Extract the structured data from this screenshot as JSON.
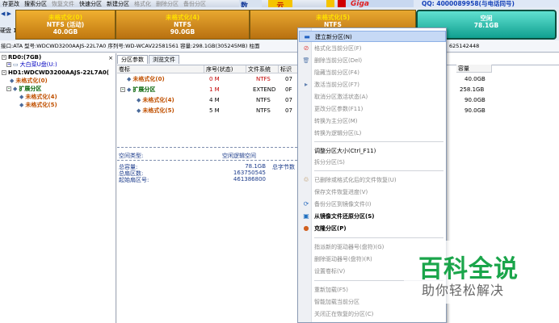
{
  "toolbar": {
    "items": [
      "存更改",
      "搜索分区",
      "恢复文件",
      "快速分区",
      "新建分区",
      "格式化",
      "删除分区",
      "备份分区"
    ],
    "ad_left": "数",
    "ad_mid": "云",
    "ad_brand": "Giga",
    "qq": "QQ: 4000089958(与电话同号)"
  },
  "diskbar": {
    "nav": "◀ ▶",
    "disk_label": "硬盘 1",
    "segments": [
      {
        "name": "未格式化(0)",
        "fs": "NTFS (活动)",
        "size": "40.0GB"
      },
      {
        "name": "未格式化(4)",
        "fs": "NTFS",
        "size": "90.0GB"
      },
      {
        "name": "未格式化(5)",
        "fs": "NTFS",
        "size": ""
      },
      {
        "name": "空闲",
        "fs": "",
        "size": "78.1GB"
      }
    ]
  },
  "infoline": "接口:ATA  型号:WDCWD3200AAJS-22L7A0  序列号:WD-WCAV22581561  容量:298.1GB(305245MB)  柱面",
  "infoline_right": "625142448",
  "tree": {
    "close": "×",
    "nodes": [
      {
        "text": "RD0:(7GB)",
        "color": "dark"
      },
      {
        "text": "大白菜U盘(U:)",
        "color": "blue"
      },
      {
        "text": "HD1:WDCWD3200AAJS-22L7A0(",
        "color": "dark"
      },
      {
        "text": "未格式化(0)",
        "color": "orange"
      },
      {
        "text": "扩展分区",
        "color": "green"
      },
      {
        "text": "未格式化(4)",
        "color": "orange"
      },
      {
        "text": "未格式化(5)",
        "color": "orange"
      }
    ]
  },
  "main": {
    "tabs": [
      "分区参数",
      "浏览文件"
    ],
    "headers": [
      "卷标",
      "序号(状态)",
      "文件系统",
      "标识"
    ],
    "rows": [
      {
        "label": "未格式化(0)",
        "num": "0 M",
        "fs": "NTFS",
        "id": "07",
        "cls": "orange"
      },
      {
        "label": "扩展分区",
        "num": "1 M",
        "fs": "EXTEND",
        "id": "0F",
        "cls": "green"
      },
      {
        "label": "未格式化(4)",
        "num": "4 M",
        "fs": "NTFS",
        "id": "07",
        "cls": "orange"
      },
      {
        "label": "未格式化(5)",
        "num": "5 M",
        "fs": "NTFS",
        "id": "07",
        "cls": "orange"
      }
    ],
    "right_header": "容量",
    "right_values": [
      "40.0GB",
      "258.1GB",
      "90.0GB",
      "90.0GB"
    ],
    "props": {
      "type_label": "空间类型:",
      "type_value": "空闲逻辑空间",
      "total_label": "总容量:",
      "total_value": "78.1GB",
      "bytes_label": "总字节数",
      "sectors_label": "总扇区数:",
      "sectors_value": "163750545",
      "start_label": "起始扇区号:",
      "start_value": "461386800"
    }
  },
  "menu": {
    "items": [
      {
        "label": "建立新分区(N)",
        "state": "sel",
        "icon": "▬"
      },
      {
        "label": "格式化当前分区(F)",
        "state": "dis",
        "icon": "⊘"
      },
      {
        "label": "删除当前分区(Del)",
        "state": "dis",
        "icon": "🗑"
      },
      {
        "label": "隐藏当前分区(F4)",
        "state": "dis",
        "icon": ""
      },
      {
        "label": "激活当前分区(F7)",
        "state": "dis",
        "icon": "▸"
      },
      {
        "label": "取消分区激活状态(A)",
        "state": "dis",
        "icon": ""
      },
      {
        "label": "更改分区参数(F11)",
        "state": "dis",
        "icon": ""
      },
      {
        "label": "转换为主分区(M)",
        "state": "dis",
        "icon": ""
      },
      {
        "label": "转换为逻辑分区(L)",
        "state": "dis",
        "icon": ""
      },
      {
        "label": "调整分区大小(Ctrl_F11)",
        "state": "normal",
        "icon": ""
      },
      {
        "label": "拆分分区(S)",
        "state": "dis",
        "icon": ""
      },
      {
        "label": "已删除或格式化后的文件恢复(U)",
        "state": "dis",
        "icon": "♲"
      },
      {
        "label": "保存文件恢复进度(V)",
        "state": "dis",
        "icon": ""
      },
      {
        "label": "备份分区到镜像文件(I)",
        "state": "dis",
        "icon": "⟳"
      },
      {
        "label": "从镜像文件还原分区(S)",
        "state": "normal",
        "icon": "▣"
      },
      {
        "label": "克隆分区(P)",
        "state": "normal",
        "icon": "●"
      },
      {
        "label": "指派新的驱动器号(盘符)(G)",
        "state": "dis",
        "icon": ""
      },
      {
        "label": "删除驱动器号(盘符)(R)",
        "state": "dis",
        "icon": ""
      },
      {
        "label": "设置卷标(V)",
        "state": "dis",
        "icon": ""
      },
      {
        "label": "重新加载(F5)",
        "state": "dis",
        "icon": ""
      },
      {
        "label": "智能加载当前分区",
        "state": "dis",
        "icon": ""
      },
      {
        "label": "关闭正在恢复的分区(C)",
        "state": "dis",
        "icon": ""
      }
    ]
  },
  "watermark": {
    "title": "百科全说",
    "subtitle": "助你轻松解决"
  }
}
